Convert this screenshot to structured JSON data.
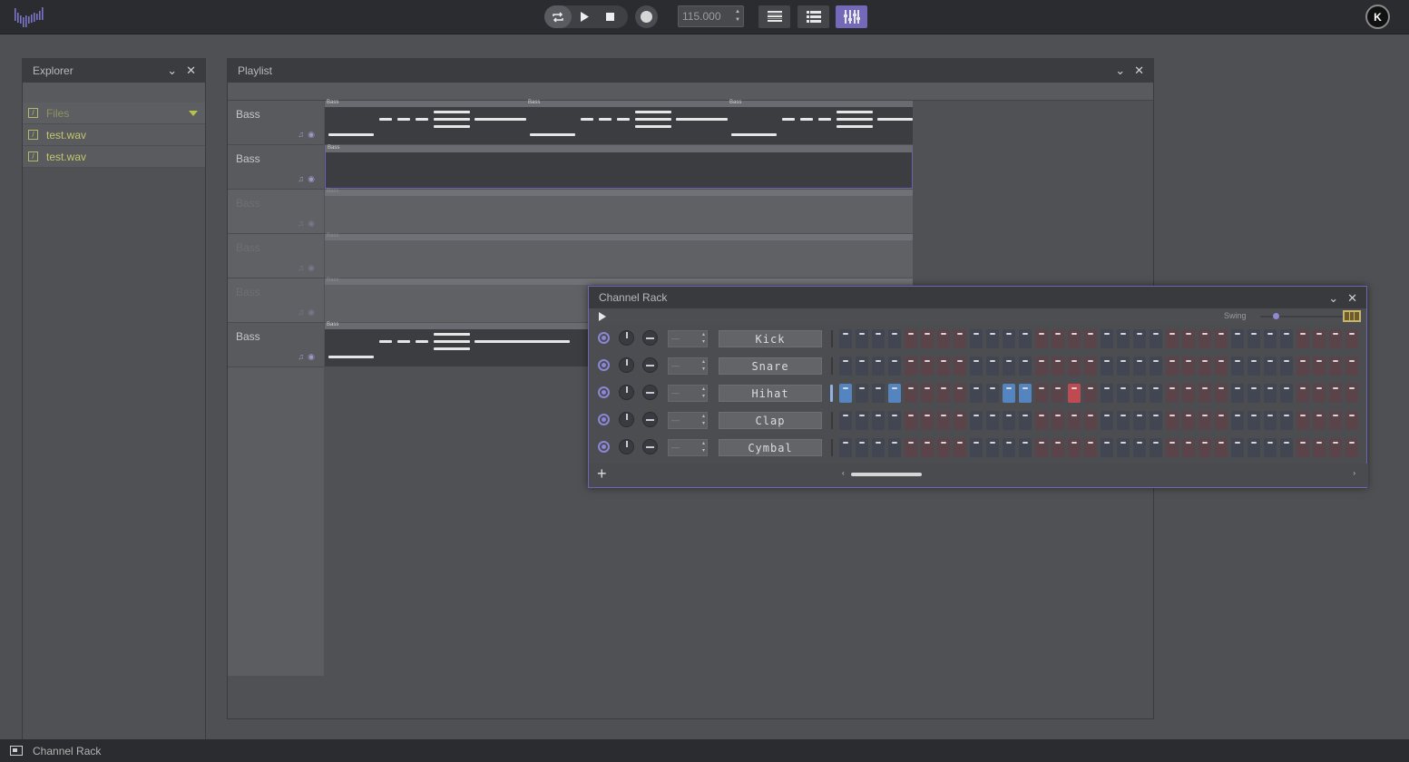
{
  "topbar": {
    "logo": "waveform-logo",
    "tempo_value": "115.000",
    "avatar_initial": "K"
  },
  "explorer": {
    "title": "Explorer",
    "folder_label": "Files",
    "files": [
      "test.wav",
      "test.wav"
    ]
  },
  "playlist": {
    "title": "Playlist",
    "tracks": [
      {
        "name": "Bass",
        "faded": false
      },
      {
        "name": "Bass",
        "faded": false
      },
      {
        "name": "Bass",
        "faded": true
      },
      {
        "name": "Bass",
        "faded": true
      },
      {
        "name": "Bass",
        "faded": true
      },
      {
        "name": "Bass",
        "faded": false
      }
    ],
    "clip_label": "Bass"
  },
  "channel_rack": {
    "title": "Channel Rack",
    "swing_label": "Swing",
    "channels": [
      {
        "name": "Kick",
        "value": "—"
      },
      {
        "name": "Snare",
        "value": "—"
      },
      {
        "name": "Hihat",
        "value": "—"
      },
      {
        "name": "Clap",
        "value": "—"
      },
      {
        "name": "Cymbal",
        "value": "—"
      }
    ],
    "hihat_active_steps": [
      0,
      3,
      10,
      11,
      14
    ]
  },
  "statusbar": {
    "label": "Channel Rack"
  },
  "colors": {
    "accent": "#7468b8",
    "step_on_blue": "#5585c0",
    "step_on_red": "#c04a52",
    "file_text": "#c3c66a"
  }
}
